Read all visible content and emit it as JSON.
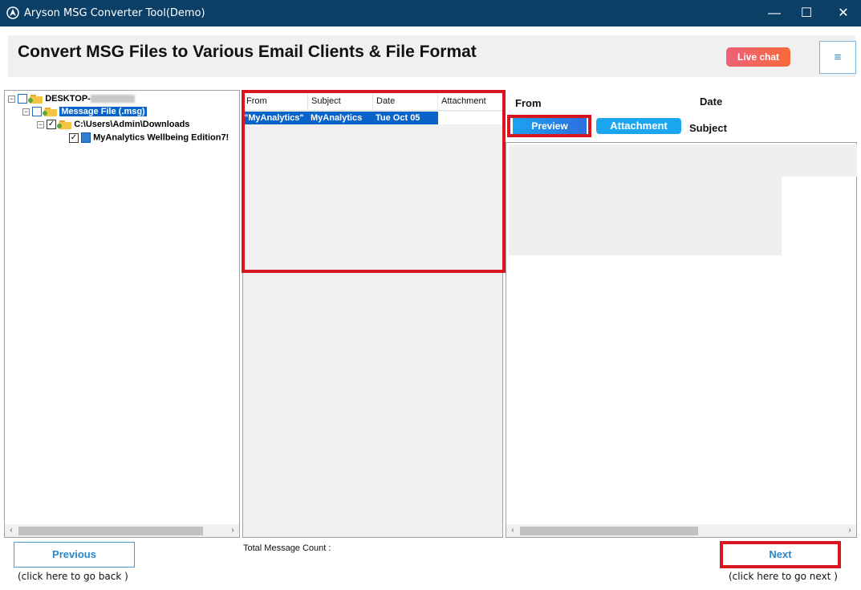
{
  "window": {
    "title": "Aryson MSG Converter Tool(Demo)",
    "minimize": "—",
    "maximize": "☐",
    "close": "✕"
  },
  "banner": {
    "headline": "Convert MSG Files to Various Email Clients & File Format",
    "live_chat": "Live chat",
    "menu_icon": "≡"
  },
  "tree": {
    "root": "DESKTOP-",
    "node1": "Message File (.msg)",
    "node2": "C:\\Users\\Admin\\Downloads",
    "node3": "MyAnalytics Wellbeing Edition7!"
  },
  "list": {
    "columns": [
      "From",
      "Subject",
      "Date",
      "Attachment"
    ],
    "rows": [
      {
        "from": "\"MyAnalytics\"",
        "subject": "MyAnalytics",
        "date": "Tue Oct 05",
        "attachment": ""
      }
    ]
  },
  "preview": {
    "from_label": "From",
    "date_label": "Date",
    "subject_label": "Subject",
    "preview_button": "Preview",
    "attachment_button": "Attachment"
  },
  "footer": {
    "previous": "Previous",
    "previous_hint": "(click here to  go back )",
    "count_label": "Total Message Count :",
    "next": "Next",
    "next_hint": "(click here to  go next )"
  },
  "colors": {
    "titlebar": "#0b3f66",
    "selection": "#0a63c9",
    "accent": "#2a86c8",
    "highlight_border": "#d9161f"
  }
}
